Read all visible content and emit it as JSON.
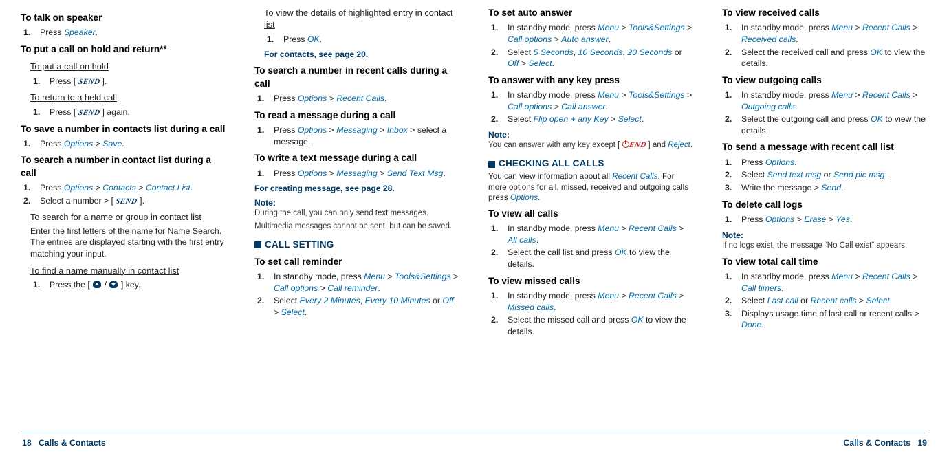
{
  "icons": {
    "send": "SEND",
    "end": "END"
  },
  "footer": {
    "left_page": "18",
    "left_section": "Calls & Contacts",
    "right_section": "Calls & Contacts",
    "right_page": "19"
  },
  "col1": {
    "h_speaker": "To talk on speaker",
    "speaker_step": "Press ",
    "speaker_ui": "Speaker",
    "h_hold": "To put a call on hold and return**",
    "h_puthold": "To put a call on hold",
    "puthold_txt_a": "Press [ ",
    "puthold_txt_b": " ].",
    "h_return": "To return to a held call",
    "return_txt_a": "Press [ ",
    "return_txt_b": " ] again.",
    "h_save": "To save a number in contacts list during a call",
    "save_a": "Press ",
    "save_options": "Options",
    "gt": " > ",
    "save_save": "Save",
    "h_search": "To search a number in contact list during a call",
    "search_a": "Press ",
    "search_opts": "Options",
    "search_contacts": "Contacts",
    "search_cl": "Contact List",
    "search2_a": "Select a number > [ ",
    "search2_b": " ].",
    "h_searchname": "To search for a name or group in contact list",
    "searchname_para": "Enter the first letters of the name for Name Search. The entries are displayed starting with the first entry matching your input.",
    "h_findman": "To find a name manually in contact list",
    "findman_a": "Press the [ ",
    "findman_mid": " / ",
    "findman_b": " ] key."
  },
  "col2": {
    "h_details": "To view the details of highlighted entry in contact list",
    "details_a": "Press ",
    "details_ok": "OK",
    "contacts_ref": "For contacts, see page 20.",
    "h_recent": "To search a number in recent calls during a call",
    "recent_a": "Press ",
    "recent_opts": "Options",
    "gt": " > ",
    "recent_rc": "Recent Calls",
    "h_readmsg": "To read a message during a call",
    "readmsg_a": "Press ",
    "readmsg_opts": "Options",
    "readmsg_msging": "Messaging",
    "readmsg_inbox": "Inbox",
    "readmsg_b": " > select a message.",
    "h_writemsg": "To write a text message during a call",
    "writemsg_a": "Press ",
    "writemsg_opts": "Options",
    "writemsg_msging": "Messaging",
    "writemsg_send": "Send Text Msg",
    "createmsg_ref": "For creating message, see page 28.",
    "note_label": "Note:",
    "note_l1": "During the call, you can only send text messages.",
    "note_l2": "Multimedia messages cannot be sent, but can be saved.",
    "h_section_callset": "CALL SETTING",
    "h_reminder": "To set call reminder",
    "rem_a": "In standby mode, press ",
    "rem_menu": "Menu",
    "rem_ts": "Tools&Settings",
    "rem_co": "Call options",
    "rem_cr": "Call reminder",
    "rem2_a": "Select ",
    "rem2_2m": "Every 2 Minutes",
    "comma": ", ",
    "rem2_10m": "Every 10 Minutes",
    "or": " or ",
    "rem2_off": "Off",
    "rem2_b": " > ",
    "rem2_sel": "Select"
  },
  "col3": {
    "h_auto": "To set auto answer",
    "auto_a": "In standby mode, press ",
    "auto_menu": "Menu",
    "gt": " > ",
    "auto_ts": "Tools&Settings",
    "auto_co": "Call options",
    "auto_aa": "Auto answer",
    "auto2_a": "Select ",
    "auto2_5": "5 Seconds",
    "comma": ", ",
    "auto2_10": "10 Seconds",
    "auto2_20": "20 Seconds",
    "or": " or ",
    "auto2_off": "Off",
    "auto2_sel": "Select",
    "h_anykey": "To answer with any key press",
    "ak_a": "In standby mode, press ",
    "ak_menu": "Menu",
    "ak_ts": "Tools&Settings",
    "ak_co": "Call options",
    "ak_ca": "Call answer",
    "ak2_a": "Select ",
    "ak2_flip": "Flip open + any Key",
    "ak2_sel": "Select",
    "note_label": "Note:",
    "note_a": "You can answer with any key except [ ",
    "note_b": " ] and ",
    "note_reject": "Reject",
    "h_section_check": "CHECKING ALL CALLS",
    "check_desc_a": "You can view information about all ",
    "check_rc": "Recent Calls",
    "check_desc_b": ". For more options for all, missed, received and outgoing calls press ",
    "check_opts": "Options",
    "h_viewall": "To view all calls",
    "va_a": "In standby mode, press ",
    "va_menu": "Menu",
    "va_rc": "Recent Calls",
    "va_all": "All calls",
    "va2_a": "Select the call list and press ",
    "va2_ok": "OK",
    "va2_b": " to view the details.",
    "h_missed": "To view missed calls",
    "m_a": "In standby mode, press ",
    "m_menu": "Menu",
    "m_rc": "Recent Calls",
    "m_mc": "Missed calls",
    "m2_a": "Select the missed call and press ",
    "m2_ok": "OK",
    "m2_b": " to view the details."
  },
  "col4": {
    "h_received": "To view received calls",
    "r_a": "In standby mode, press ",
    "r_menu": "Menu",
    "gt": " > ",
    "r_rc": "Recent Calls",
    "r_rcv": "Received calls",
    "r2_a": "Select the received call and press ",
    "r2_ok": "OK",
    "r2_b": " to view the details.",
    "h_outgoing": "To view outgoing calls",
    "o_a": "In standby mode, press ",
    "o_menu": "Menu",
    "o_rc": "Recent Calls",
    "o_out": "Outgoing calls",
    "o2_a": "Select the outgoing call and press ",
    "o2_ok": "OK",
    "o2_b": " to view the details.",
    "h_sendmsg": "To send a message with recent call list",
    "s1_a": "Press ",
    "s1_opts": "Options",
    "s2_a": "Select ",
    "s2_txtmsg": "Send text msg",
    "or": " or ",
    "s2_picmsg": "Send pic msg",
    "s3_a": "Write the message > ",
    "s3_send": "Send",
    "h_delete": "To delete call logs",
    "d_a": "Press ",
    "d_opts": "Options",
    "d_erase": "Erase",
    "d_yes": "Yes",
    "note_label": "Note:",
    "note_txt": "If no logs exist, the message “No Call exist” appears.",
    "h_totaltime": "To view total call time",
    "t_a": "In standby mode, press ",
    "t_menu": "Menu",
    "t_rc": "Recent Calls",
    "t_ct": "Call timers",
    "t2_a": "Select ",
    "t2_last": "Last call",
    "t2_recent": "Recent calls",
    "t2_sel": "Select",
    "t3_a": "Displays usage time of last call or recent calls > ",
    "t3_done": "Done"
  }
}
